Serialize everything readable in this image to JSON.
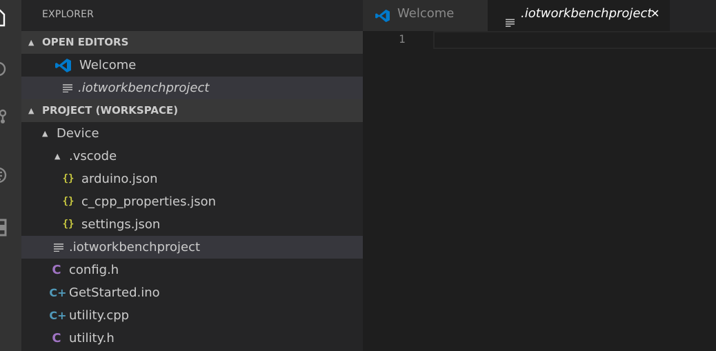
{
  "explorer": {
    "title": "EXPLORER",
    "open_editors": {
      "header": "OPEN EDITORS",
      "items": [
        {
          "label": "Welcome",
          "icon": "vscode-icon"
        },
        {
          "label": ".iotworkbenchproject",
          "icon": "lines-file-icon"
        }
      ]
    },
    "workspace": {
      "header": "PROJECT (WORKSPACE)",
      "tree": [
        {
          "label": "Device",
          "type": "folder"
        },
        {
          "label": ".vscode",
          "type": "folder"
        },
        {
          "label": "arduino.json",
          "type": "json"
        },
        {
          "label": "c_cpp_properties.json",
          "type": "json"
        },
        {
          "label": "settings.json",
          "type": "json"
        },
        {
          "label": ".iotworkbenchproject",
          "type": "text"
        },
        {
          "label": "config.h",
          "type": "c"
        },
        {
          "label": "GetStarted.ino",
          "type": "cpp"
        },
        {
          "label": "utility.cpp",
          "type": "cpp"
        },
        {
          "label": "utility.h",
          "type": "c"
        }
      ]
    },
    "glyphs": {
      "json": "{}",
      "c": "C",
      "cpp": "C+"
    }
  },
  "editor": {
    "tabs": [
      {
        "label": "Welcome",
        "active": false
      },
      {
        "label": ".iotworkbenchproject",
        "active": true
      }
    ],
    "close_glyph": "✕",
    "line_numbers": [
      "1"
    ]
  },
  "colors": {
    "activity_bar": "#333333",
    "sidebar": "#252526",
    "section_header": "#383838",
    "selection": "#37373d",
    "editor": "#1e1e1e",
    "json_icon": "#cbcb41",
    "c_icon": "#a074c4",
    "cpp_icon": "#519aba",
    "vscode_blue": "#007acc"
  }
}
